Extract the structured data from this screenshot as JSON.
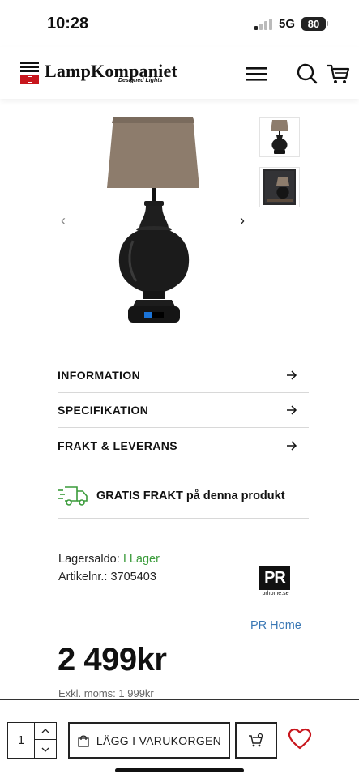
{
  "status_bar": {
    "time": "10:28",
    "network": "5G",
    "battery": "80"
  },
  "header": {
    "brand_name": "LampKompaniet",
    "tagline": "Designed Lights",
    "icons": [
      "menu-icon",
      "search-icon",
      "cart-icon"
    ]
  },
  "gallery": {
    "prev_icon": "‹",
    "next_icon": "›",
    "thumbnail_count": 2
  },
  "accordion": {
    "items": [
      {
        "label": "INFORMATION"
      },
      {
        "label": "SPECIFIKATION"
      },
      {
        "label": "FRAKT & LEVERANS"
      }
    ]
  },
  "shipping": {
    "label": "GRATIS FRAKT på denna produkt"
  },
  "stock": {
    "stock_label": "Lagersaldo:",
    "stock_value": "I Lager",
    "article_label": "Artikelnr.:",
    "article_value": "3705403"
  },
  "brand": {
    "logo_text": "PR",
    "logo_url": "prhome.se",
    "link": "PR Home"
  },
  "price": {
    "amount": "2 499kr",
    "ex_vat": "Exkl. moms: 1 999kr"
  },
  "purchase": {
    "quantity": "1",
    "add_to_cart": "LÄGG I VARUKORGEN"
  },
  "colors": {
    "in_stock": "#3a9b3a",
    "link": "#3a78b5",
    "heart": "#c8161d",
    "logo_red": "#c8161d"
  }
}
